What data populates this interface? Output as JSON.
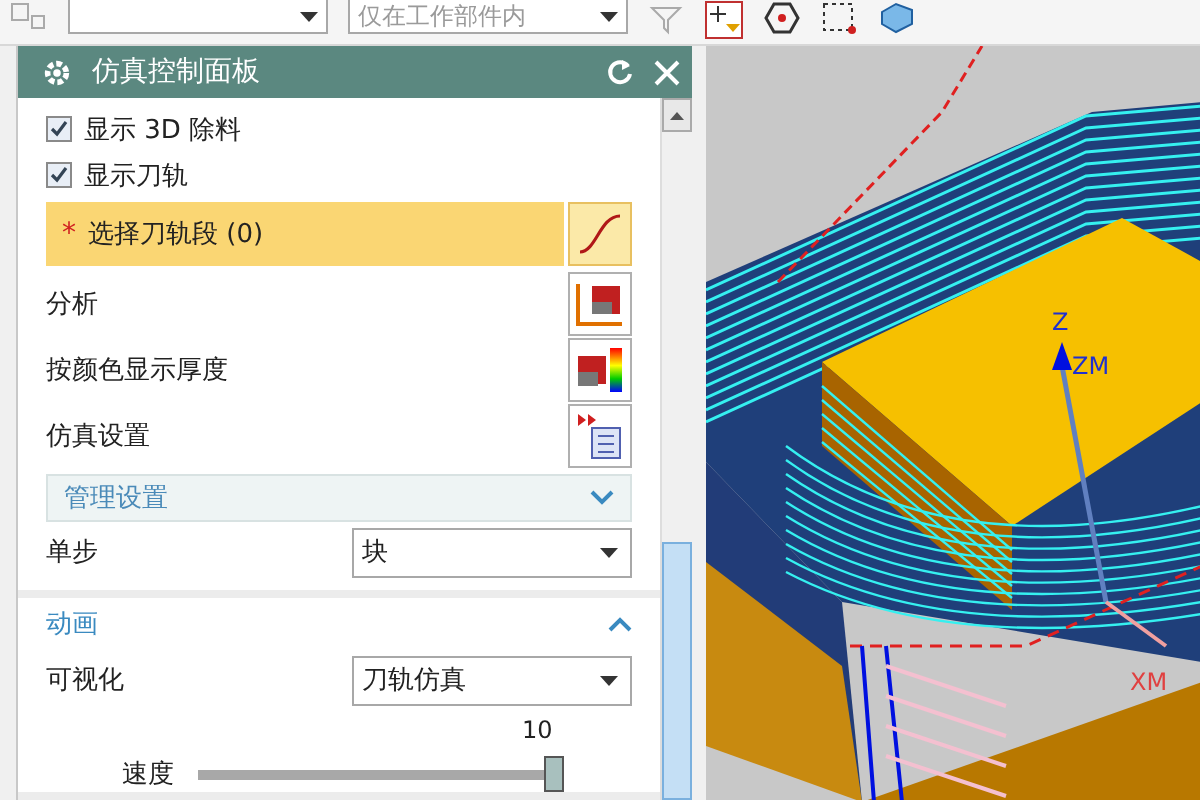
{
  "toolbar": {
    "scope_dropdown": "仅在工作部件内"
  },
  "panel": {
    "title": "仿真控制面板",
    "checkboxes": [
      {
        "label": "显示 3D 除料",
        "checked": true
      },
      {
        "label": "显示刀轨",
        "checked": true
      }
    ],
    "selection": {
      "required_mark": "*",
      "label": "选择刀轨段 (0)"
    },
    "actions": [
      {
        "label": "分析",
        "kind": "analysis"
      },
      {
        "label": "按颜色显示厚度",
        "kind": "thickness"
      },
      {
        "label": "仿真设置",
        "kind": "settings"
      }
    ],
    "group": {
      "label": "管理设置",
      "expanded": false
    },
    "step": {
      "label": "单步",
      "value": "块"
    },
    "animation": {
      "title": "动画",
      "expanded": true,
      "visualize": {
        "label": "可视化",
        "value": "刀轨仿真"
      },
      "speed": {
        "label": "速度",
        "reading": "10",
        "level": 1.0
      }
    }
  },
  "viewport": {
    "axis_labels": [
      "Z",
      "ZM",
      "XM"
    ]
  }
}
